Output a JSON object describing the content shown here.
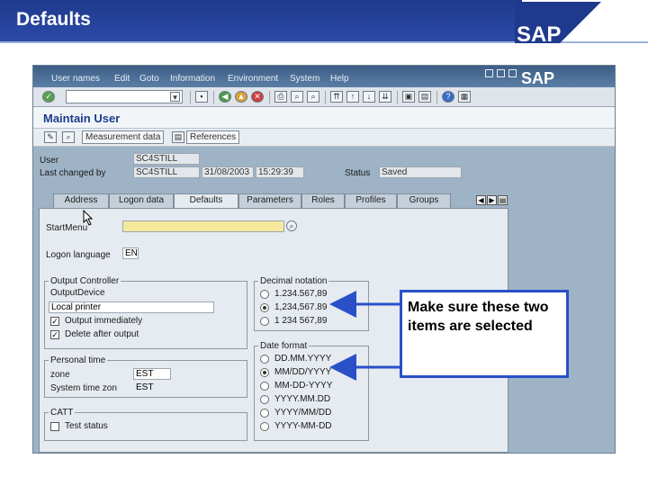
{
  "slide": {
    "title": "Defaults",
    "logo_text": "SAP"
  },
  "menubar": {
    "items": [
      "User names",
      "Edit",
      "Goto",
      "Information",
      "Environment",
      "System",
      "Help"
    ],
    "logo_text": "SAP"
  },
  "screen": {
    "title": "Maintain User"
  },
  "app_toolbar": {
    "measurement_label": "Measurement data",
    "references_label": "References"
  },
  "header": {
    "user_label": "User",
    "user_value": "SC4STILL",
    "last_changed_label": "Last changed by",
    "last_changed_value": "SC4STILL",
    "date_value": "31/08/2003",
    "time_value": "15:29:39",
    "status_label": "Status",
    "status_value": "Saved"
  },
  "tabs": [
    "Address",
    "Logon data",
    "Defaults",
    "Parameters",
    "Roles",
    "Profiles",
    "Groups"
  ],
  "defaults": {
    "start_menu_label": "StartMenu",
    "start_menu_value": "",
    "logon_lang_label": "Logon language",
    "logon_lang_value": "EN"
  },
  "output_group": {
    "title": "Output Controller",
    "device_label": "OutputDevice",
    "device_value": "",
    "local_printer_label": "Local printer",
    "output_immediately_label": "Output immediately",
    "output_immediately_checked": true,
    "delete_after_output_label": "Delete after output",
    "delete_after_output_checked": true
  },
  "personal_time": {
    "title": "Personal time",
    "zone_label": "zone",
    "zone_value": "EST",
    "system_zone_label": "System time zon",
    "system_zone_value": "EST"
  },
  "catt": {
    "title": "CATT",
    "test_status_label": "Test status",
    "test_status_checked": false
  },
  "decimal_notation": {
    "title": "Decimal notation",
    "options": [
      "1.234.567,89",
      "1,234,567.89",
      "1 234 567,89"
    ],
    "selected_index": 1
  },
  "date_format": {
    "title": "Date format",
    "options": [
      "DD.MM.YYYY",
      "MM/DD/YYYY",
      "MM-DD-YYYY",
      "YYYY.MM.DD",
      "YYYY/MM/DD",
      "YYYY-MM-DD"
    ],
    "selected_index": 1
  },
  "callout": {
    "text": "Make sure these two items are selected"
  },
  "colors": {
    "slide_blue": "#1f3a8c",
    "callout_border": "#2a50c8",
    "arrow": "#2a50c8",
    "highlight_field": "#f6e99c"
  }
}
